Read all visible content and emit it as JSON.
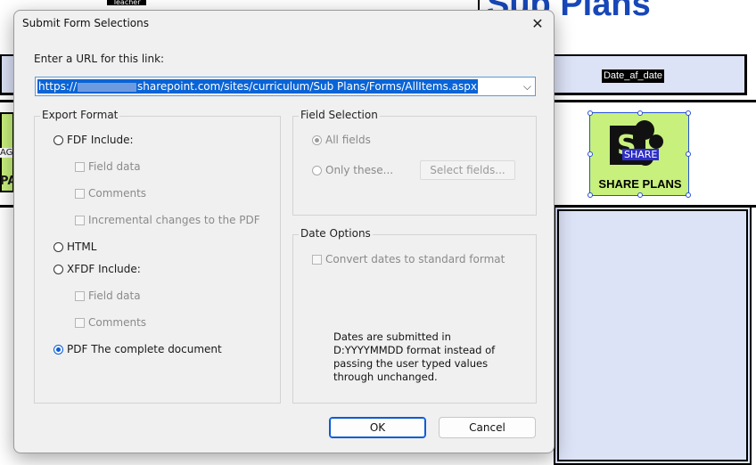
{
  "background": {
    "top_label": "Teacher",
    "title": "Sub Plans",
    "date_field": "Date_af_date",
    "share_tag": "SHARE",
    "share_label": "SHARE PLANS",
    "left_text": "PA",
    "left_text_small": "AG"
  },
  "dialog": {
    "title": "Submit Form Selections",
    "close_glyph": "✕",
    "url_label": "Enter a URL for this link:",
    "url_prefix": "https://",
    "url_suffix": "sharepoint.com/sites/curriculum/Sub Plans/Forms/AllItems.aspx",
    "dropdown_glyph": "⌵",
    "export_format": {
      "label": "Export Format",
      "fdf": "FDF  Include:",
      "fdf_field_data": "Field data",
      "fdf_comments": "Comments",
      "fdf_incremental": "Incremental changes to the PDF",
      "html": "HTML",
      "xfdf": "XFDF  Include:",
      "xfdf_field_data": "Field data",
      "xfdf_comments": "Comments",
      "pdf": "PDF  The complete document",
      "selected": "pdf"
    },
    "field_selection": {
      "label": "Field Selection",
      "all_fields": "All fields",
      "only_these": "Only these...",
      "select_fields_button": "Select fields..."
    },
    "date_options": {
      "label": "Date Options",
      "convert_dates": "Convert dates to standard format",
      "note": "Dates are submitted in D:YYYYMMDD format instead of passing the user typed values through unchanged."
    },
    "ok_label": "OK",
    "cancel_label": "Cancel"
  },
  "colors": {
    "accent": "#0a5bd6",
    "share_green": "#c8f07c",
    "title_blue": "#1747b8",
    "row_lavender": "#dde3f7"
  }
}
